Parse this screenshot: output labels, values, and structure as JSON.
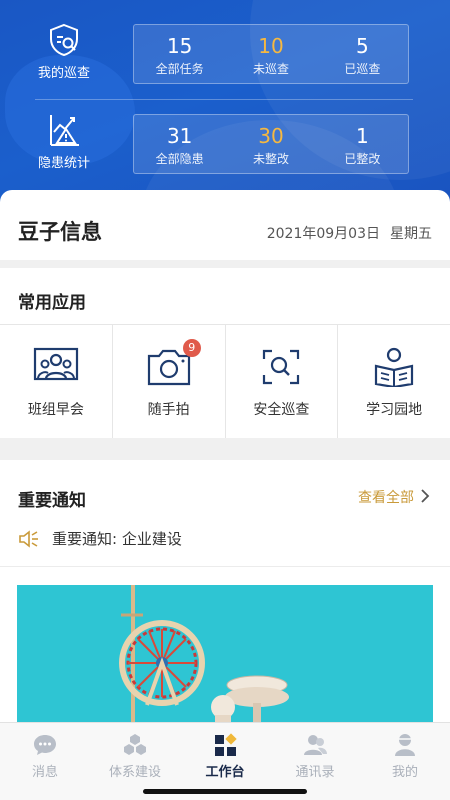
{
  "header": {
    "inspection": {
      "label": "我的巡查",
      "stats": [
        {
          "value": "15",
          "caption": "全部任务"
        },
        {
          "value": "10",
          "caption": "未巡查"
        },
        {
          "value": "5",
          "caption": "已巡查"
        }
      ]
    },
    "hazard": {
      "label": "隐患统计",
      "stats": [
        {
          "value": "31",
          "caption": "全部隐患"
        },
        {
          "value": "30",
          "caption": "未整改"
        },
        {
          "value": "1",
          "caption": "已整改"
        }
      ]
    }
  },
  "info": {
    "name": "豆子信息",
    "date": "2021年09月03日",
    "weekday": "星期五"
  },
  "apps": {
    "title": "常用应用",
    "items": [
      {
        "label": "班组早会",
        "icon": "meeting-icon"
      },
      {
        "label": "随手拍",
        "icon": "camera-icon",
        "badge": "9"
      },
      {
        "label": "安全巡查",
        "icon": "scan-inspect-icon"
      },
      {
        "label": "学习园地",
        "icon": "reading-icon"
      }
    ]
  },
  "notice": {
    "title": "重要通知",
    "more": "查看全部",
    "item": "重要通知: 企业建设"
  },
  "tabs": [
    {
      "label": "消息",
      "icon": "chat-bubble-icon"
    },
    {
      "label": "体系建设",
      "icon": "cubes-icon"
    },
    {
      "label": "工作台",
      "icon": "workbench-icon",
      "active": true
    },
    {
      "label": "通讯录",
      "icon": "contacts-icon"
    },
    {
      "label": "我的",
      "icon": "profile-icon"
    }
  ],
  "colors": {
    "header_blue": "#1b5fcc",
    "accent_number": "#f5b841",
    "link_gold": "#c99a3a",
    "icon_navy": "#1f3c6e",
    "badge_red": "#e05a4b"
  }
}
